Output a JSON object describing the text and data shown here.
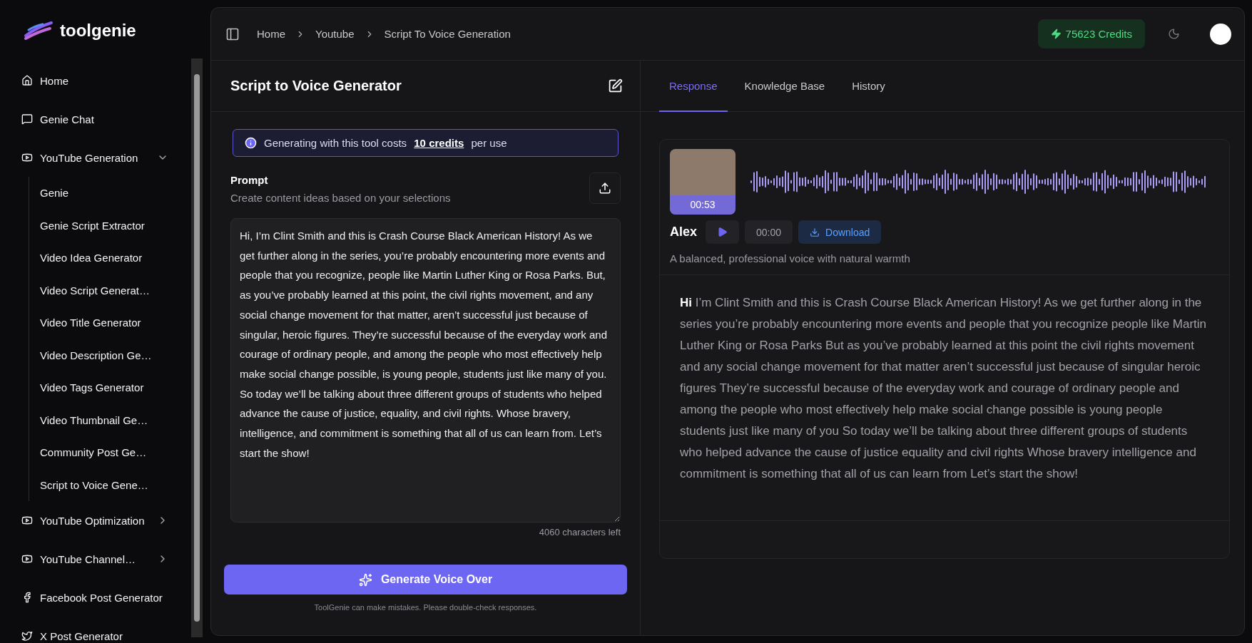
{
  "logo": {
    "name": "toolgenie"
  },
  "sidebar": {
    "items": [
      {
        "label": "Home"
      },
      {
        "label": "Genie Chat"
      },
      {
        "label": "YouTube Generation",
        "expanded": true,
        "children": [
          {
            "label": "Genie"
          },
          {
            "label": "Genie Script Extractor"
          },
          {
            "label": "Video Idea Generator"
          },
          {
            "label": "Video Script Generat…"
          },
          {
            "label": "Video Title Generator"
          },
          {
            "label": "Video Description Ge…"
          },
          {
            "label": "Video Tags Generator"
          },
          {
            "label": "Video Thumbnail Ge…"
          },
          {
            "label": "Community Post Ge…"
          },
          {
            "label": "Script to Voice Gene…"
          }
        ]
      },
      {
        "label": "YouTube Optimization",
        "expanded": false
      },
      {
        "label": "YouTube Channel…",
        "expanded": false
      },
      {
        "label": "Facebook Post Generator"
      },
      {
        "label": "X Post Generator"
      }
    ]
  },
  "header": {
    "breadcrumbs": [
      "Home",
      "Youtube",
      "Script To Voice Generation"
    ],
    "credits": "75623 Credits"
  },
  "tool": {
    "title": "Script to Voice Generator",
    "notice": {
      "before": "Generating with this tool costs",
      "link": "10 credits",
      "after": "per use"
    },
    "prompt": {
      "label": "Prompt",
      "hint": "Create content ideas based on your selections",
      "value": "Hi, I’m Clint Smith and this is Crash Course Black American History! As we get further along in the series, you’re probably encountering more events and people that you recognize, people like Martin Luther King or Rosa Parks. But, as you’ve probably learned at this point, the civil rights movement, and any social change movement for that matter, aren’t successful just because of singular, heroic figures. They’re successful because of the everyday work and courage of ordinary people, and among the people who most effectively help make social change possible, is young people, students just like many of you. So today we’ll be talking about three different groups of students who helped advance the cause of justice, equality, and civil rights. Whose bravery, intelligence, and commitment is something that all of us can learn from. Let’s start the show!",
      "counter": "4060 characters left"
    },
    "button": "Generate Voice Over",
    "disclaimer": "ToolGenie can make mistakes. Please double-check responses."
  },
  "tabs": [
    {
      "label": "Response",
      "selected": true
    },
    {
      "label": "Knowledge Base",
      "selected": false
    },
    {
      "label": "History",
      "selected": false
    }
  ],
  "voice": {
    "duration": "00:53",
    "name": "Alex",
    "time": "00:00",
    "download": "Download",
    "description": "A balanced, professional voice with natural warmth",
    "transcript": "**Hi** I’m Clint Smith and this is Crash Course Black American History! As we get further along in the series you’re probably encountering more events and people that you recognize people like Martin Luther King or Rosa Parks But as you’ve probably learned at this point the civil rights movement and any social change movement for that matter aren’t successful just because of singular heroic figures They’re successful because of the everyday work and courage of ordinary people and among the people who most effectively help make social change possible is young people students just like many of you So today we’ll be talking about three different groups of students who helped advance the cause of justice equality and civil rights Whose bravery intelligence and commitment is something that all of us can learn from Let’s start the show!"
  }
}
